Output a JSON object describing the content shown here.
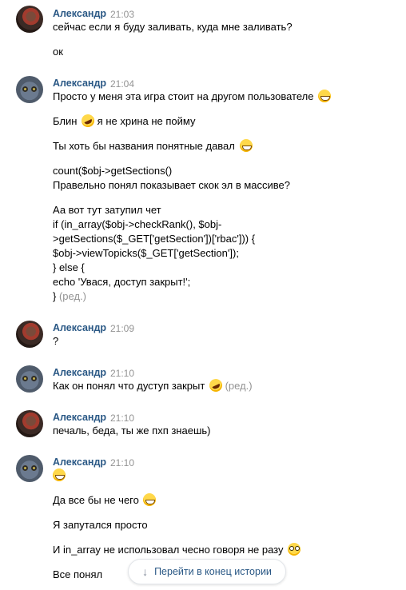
{
  "messages": [
    {
      "author": "Александр",
      "time": "21:03",
      "avatar": "person-avatar",
      "lines": [
        "сейчас если я буду заливать, куда мне заливать?",
        "ок"
      ]
    },
    {
      "author": "Александр",
      "time": "21:04",
      "avatar": "cat-avatar",
      "lines": [
        "Просто у меня эта игра стоит на другом пользователе",
        "Блин",
        "я не хрина не пойму",
        "Ты хоть бы названия понятные давал",
        "count($obj->getSections()",
        "Правельно понял показывает скок эл в массиве?",
        "Аа вот тут затупил чет",
        "if (in_array($obj->checkRank(), $obj-",
        ">getSections($_GET['getSection'])['rbac'])) {",
        "$obj->viewTopicks($_GET['getSection']);",
        "} else {",
        "echo 'Увася, доступ закрыт!';",
        "}"
      ],
      "edited": "(ред.)"
    },
    {
      "author": "Александр",
      "time": "21:09",
      "avatar": "person-avatar",
      "lines": [
        "?"
      ]
    },
    {
      "author": "Александр",
      "time": "21:10",
      "avatar": "cat-avatar",
      "lines": [
        "Как он понял что дуступ закрыт"
      ],
      "edited": "(ред.)"
    },
    {
      "author": "Александр",
      "time": "21:10",
      "avatar": "person-avatar",
      "lines": [
        "печаль, беда, ты же пхп знаешь)"
      ]
    },
    {
      "author": "Александр",
      "time": "21:10",
      "avatar": "cat-avatar",
      "lines": [
        "Да все бы не чего",
        "Я запутался просто",
        "И in_array не использовал чесно говоря не разу",
        "Все понял"
      ]
    }
  ],
  "jump_button": {
    "label": "Перейти в конец истории",
    "icon": "arrow-down-icon"
  },
  "colors": {
    "author": "#2a5885",
    "meta": "#939393",
    "background": "#ffffff"
  }
}
